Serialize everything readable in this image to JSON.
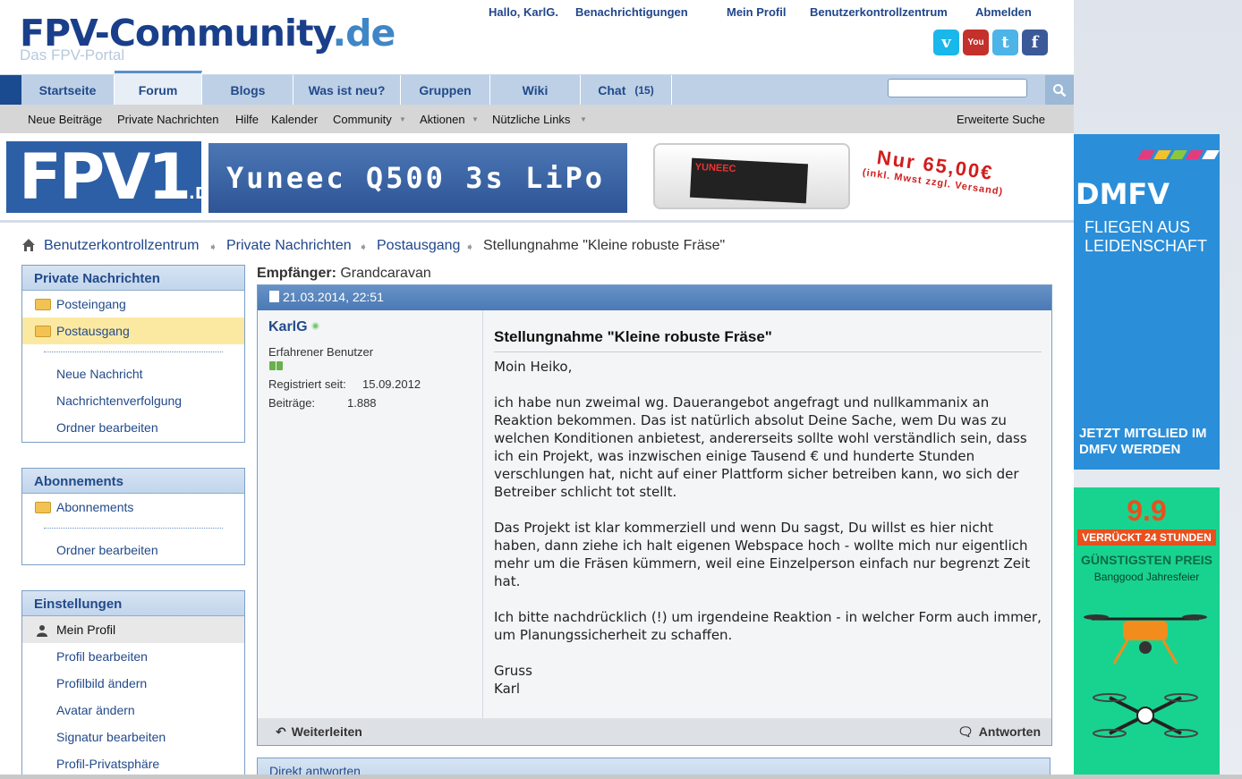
{
  "header": {
    "logo_main_a": "FPV-Community",
    "logo_main_b": ".de",
    "logo_sub": "Das FPV-Portal",
    "greeting": "Hallo, KarlG.",
    "links": [
      "Benachrichtigungen",
      "Mein Profil",
      "Benutzerkontrollzentrum",
      "Abmelden"
    ]
  },
  "nav": {
    "tabs": [
      "Startseite",
      "Forum",
      "Blogs",
      "Was ist neu?",
      "Gruppen",
      "Wiki",
      "Chat"
    ],
    "chat_count": "(15)",
    "search_value": "",
    "active_tab": "Forum"
  },
  "subnav": {
    "items": [
      "Neue Beiträge",
      "Private Nachrichten",
      "Hilfe",
      "Kalender",
      "Community",
      "Aktionen",
      "Nützliche Links"
    ],
    "advanced_search": "Erweiterte Suche"
  },
  "banner": {
    "fpv1": "FPV1",
    "fpv1_sub": ".DE",
    "product": "Yuneec Q500 3s LiPo",
    "battery_label": "YUNEEC",
    "price_line1": "Nur 65,00€",
    "price_line2": "(inkl. Mwst zzgl. Versand)"
  },
  "breadcrumb": [
    "Benutzerkontrollzentrum",
    "Private Nachrichten",
    "Postausgang",
    "Stellungnahme \"Kleine robuste Fräse\""
  ],
  "sidebar": {
    "pm": {
      "title": "Private Nachrichten",
      "folders": [
        "Posteingang",
        "Postausgang"
      ],
      "links": [
        "Neue Nachricht",
        "Nachrichtenverfolgung",
        "Ordner bearbeiten"
      ]
    },
    "subs": {
      "title": "Abonnements",
      "folders": [
        "Abonnements"
      ],
      "links": [
        "Ordner bearbeiten"
      ]
    },
    "settings": {
      "title": "Einstellungen",
      "items": [
        "Mein Profil",
        "Profil bearbeiten",
        "Profilbild ändern",
        "Avatar ändern",
        "Signatur bearbeiten",
        "Profil-Privatsphäre"
      ]
    }
  },
  "message": {
    "recipient_label": "Empfänger:",
    "recipient": "Grandcaravan",
    "date": "21.03.2014, 22:51",
    "username": "KarlG",
    "user_title": "Erfahrener Benutzer",
    "registered_label": "Registriert seit:",
    "registered_value": "15.09.2012",
    "posts_label": "Beiträge:",
    "posts_value": "1.888",
    "title": "Stellungnahme \"Kleine robuste Fräse\"",
    "paragraphs": [
      "Moin Heiko,",
      "ich habe nun zweimal wg. Dauerangebot angefragt und nullkammanix an Reaktion bekommen. Das ist natürlich absolut Deine Sache, wem Du was zu welchen Konditionen anbietest, andererseits sollte wohl verständlich sein, dass ich ein Projekt, was inzwischen einige Tausend € und hunderte Stunden verschlungen hat, nicht auf einer Plattform sicher betreiben kann, wo sich der Betreiber schlicht tot stellt.",
      "Das Projekt ist klar kommerziell und wenn Du sagst, Du willst es hier nicht haben, dann ziehe ich halt eigenen Webspace hoch - wollte mich nur eigentlich mehr um die Fräsen kümmern, weil eine Einzelperson einfach nur begrenzt Zeit hat.",
      "Ich bitte nachdrücklich (!) um irgendeine Reaktion - in welcher Form auch immer, um Planungssicherheit zu schaffen.",
      "Gruss\nKarl"
    ],
    "forward_label": "Weiterleiten",
    "reply_label": "Antworten",
    "quick_reply_title": "Direkt antworten"
  },
  "ads": {
    "dmfv_logo": "DMFV",
    "dmfv_slogan": "FLIEGEN AUS LEIDENSCHAFT",
    "dmfv_join": "JETZT MITGLIED IM DMFV WERDEN",
    "bg_number": "9.9",
    "bg_crazy": "VERRÜCKT 24 STUNDEN",
    "bg_best": "GÜNSTIGSTEN PREIS",
    "bg_sub": "Banggood Jahresfeier"
  },
  "colors": {
    "brand_dark": "#1a3f8a",
    "brand_light": "#3f86c7",
    "nav_bg": "#bdd0e6",
    "dmfv_blue": "#2a8ed9",
    "banggood_green": "#18d38f"
  }
}
